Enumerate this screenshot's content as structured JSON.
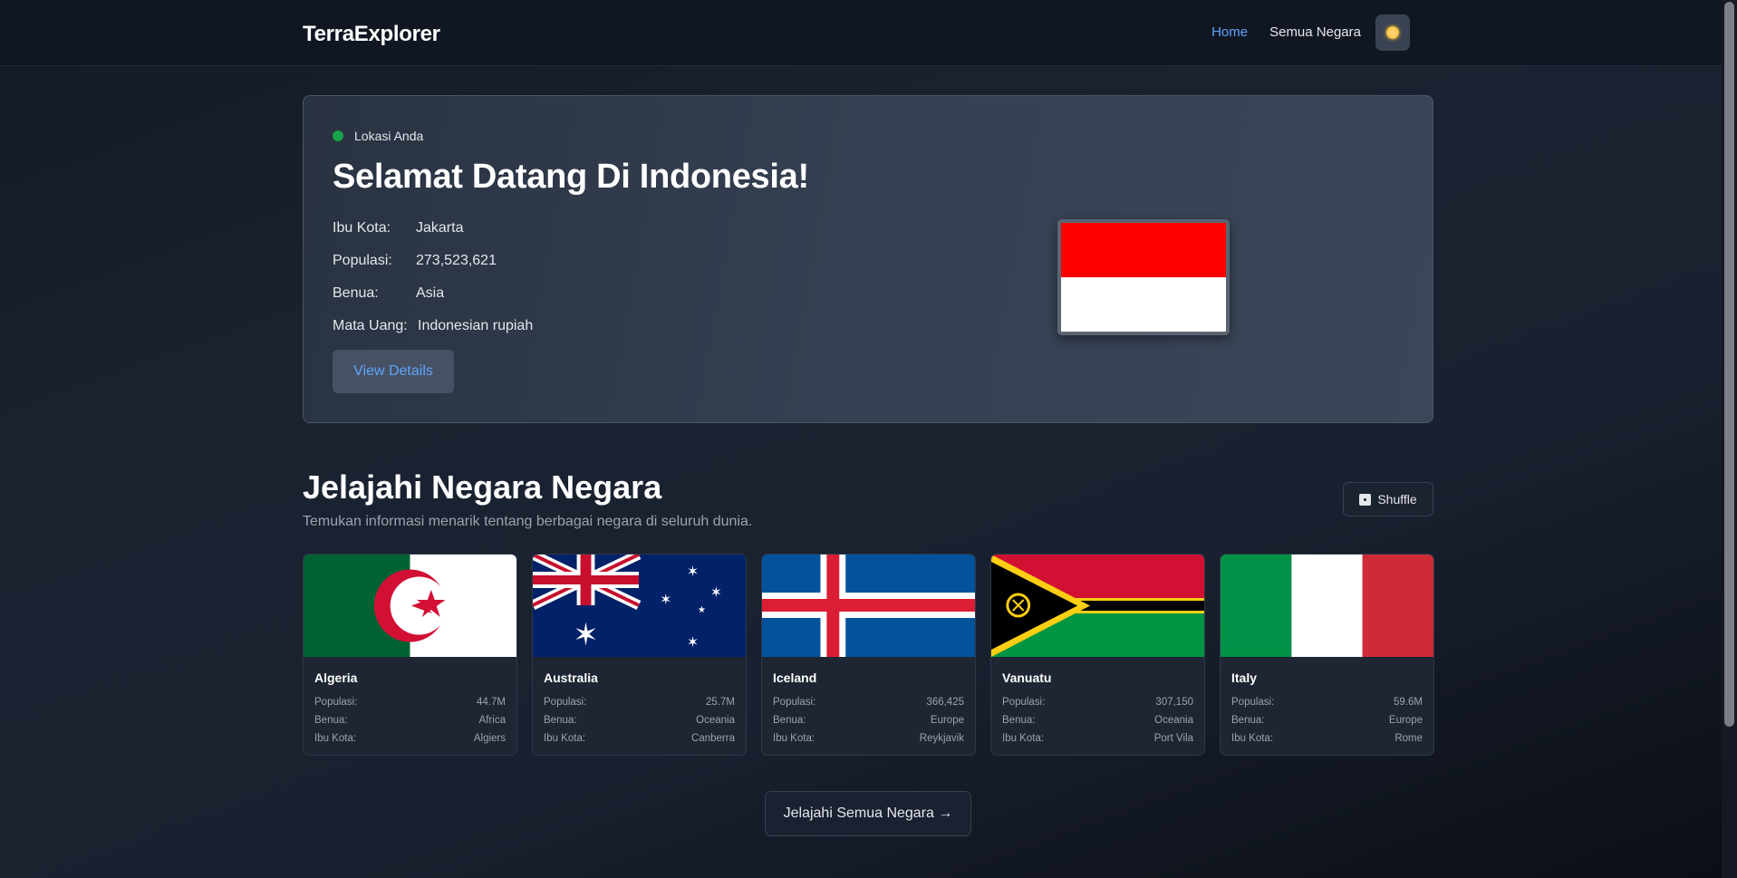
{
  "nav": {
    "brand": "TerraExplorer",
    "links": [
      "Home",
      "Semua Negara"
    ],
    "theme_icon": "sun-icon"
  },
  "hero": {
    "location_label": "Lokasi Anda",
    "title": "Selamat Datang Di Indonesia!",
    "capital_label": "Ibu Kota:",
    "capital": "Jakarta",
    "population_label": "Populasi:",
    "population": "273,523,621",
    "continent_label": "Benua:",
    "continent": "Asia",
    "currency_label": "Mata Uang:",
    "currency": "Indonesian rupiah",
    "button": "View Details",
    "flag_colors": [
      "#ff0000",
      "#ffffff"
    ]
  },
  "explore": {
    "title": "Jelajahi Negara Negara",
    "subtitle": "Temukan informasi menarik tentang berbagai negara di seluruh dunia.",
    "shuffle": "Shuffle",
    "shuffle_icon": "dice-icon",
    "cta": "Jelajahi Semua Negara →"
  },
  "labels": {
    "population": "Populasi:",
    "continent": "Benua:",
    "capital": "Ibu Kota:"
  },
  "cards": [
    {
      "name": "Algeria",
      "population": "44.7M",
      "continent": "Africa",
      "capital": "Algiers"
    },
    {
      "name": "Australia",
      "population": "25.7M",
      "continent": "Oceania",
      "capital": "Canberra"
    },
    {
      "name": "Iceland",
      "population": "366,425",
      "continent": "Europe",
      "capital": "Reykjavik"
    },
    {
      "name": "Vanuatu",
      "population": "307,150",
      "continent": "Oceania",
      "capital": "Port Vila"
    },
    {
      "name": "Italy",
      "population": "59.6M",
      "continent": "Europe",
      "capital": "Rome"
    }
  ],
  "colors": {
    "accent": "#60a5fa",
    "location_dot": "#16a34a"
  }
}
